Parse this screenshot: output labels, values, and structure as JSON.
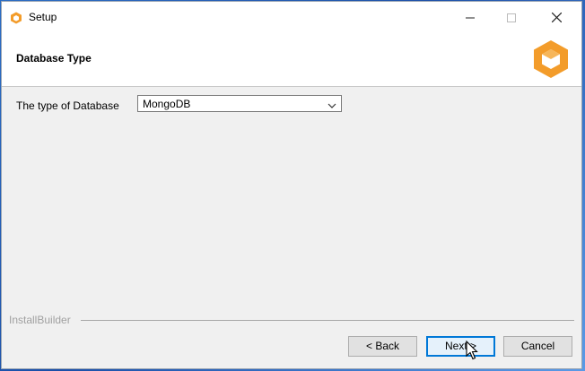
{
  "window": {
    "title": "Setup"
  },
  "header": {
    "title": "Database Type"
  },
  "form": {
    "db_type_label": "The type of Database",
    "db_type_value": "MongoDB"
  },
  "footer": {
    "brand": "InstallBuilder",
    "back_label": "< Back",
    "next_label": "Next >",
    "cancel_label": "Cancel"
  },
  "icons": {
    "app": "orange-box-icon",
    "logo": "orange-box-logo",
    "minimize": "minimize-icon",
    "maximize": "maximize-icon",
    "close": "close-icon",
    "dropdown": "chevron-down-icon"
  },
  "colors": {
    "accent": "#0078d7",
    "brand_orange": "#f39c2a"
  }
}
